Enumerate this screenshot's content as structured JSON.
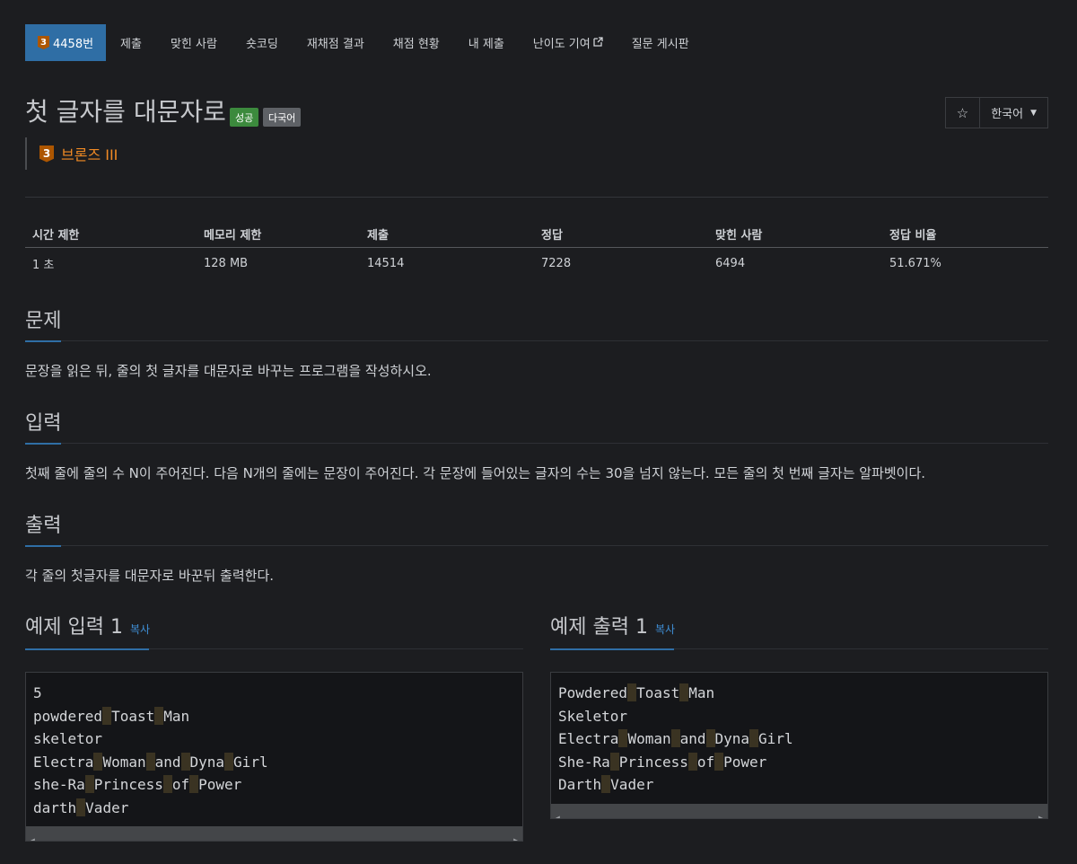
{
  "tabs": [
    {
      "label": "4458번",
      "tier_badge": "3"
    },
    {
      "label": "제출"
    },
    {
      "label": "맞힌 사람"
    },
    {
      "label": "숏코딩"
    },
    {
      "label": "재채점 결과"
    },
    {
      "label": "채점 현황"
    },
    {
      "label": "내 제출"
    },
    {
      "label": "난이도 기여"
    },
    {
      "label": "질문 게시판"
    }
  ],
  "problem": {
    "title": "첫 글자를 대문자로",
    "label_success": "성공",
    "label_multilang": "다국어",
    "tier_number": "3",
    "tier_name": "브론즈 III"
  },
  "controls": {
    "star": "☆",
    "language": "한국어"
  },
  "stats": {
    "headers": [
      "시간 제한",
      "메모리 제한",
      "제출",
      "정답",
      "맞힌 사람",
      "정답 비율"
    ],
    "values": [
      "1 초",
      "128 MB",
      "14514",
      "7228",
      "6494",
      "51.671%"
    ]
  },
  "sections": {
    "problem": {
      "title": "문제",
      "text": "문장을 읽은 뒤, 줄의 첫 글자를 대문자로 바꾸는 프로그램을 작성하시오."
    },
    "input": {
      "title": "입력",
      "text": "첫째 줄에 줄의 수 N이 주어진다. 다음 N개의 줄에는 문장이 주어진다. 각 문장에 들어있는 글자의 수는 30을 넘지 않는다. 모든 줄의 첫 번째 글자는 알파벳이다."
    },
    "output": {
      "title": "출력",
      "text": "각 줄의 첫글자를 대문자로 바꾼뒤 출력한다."
    }
  },
  "examples": {
    "input_title": "예제 입력 1",
    "output_title": "예제 출력 1",
    "copy_label": "복사",
    "input_lines": [
      "5",
      "powdered Toast Man",
      "skeletor",
      "Electra Woman and Dyna Girl",
      "she-Ra Princess of Power",
      "darth Vader"
    ],
    "output_lines": [
      "Powdered Toast Man",
      "Skeletor",
      "Electra Woman and Dyna Girl",
      "She-Ra Princess of Power",
      "Darth Vader"
    ]
  },
  "colors": {
    "accent": "#2f6ea5",
    "bronze": "#ad5600",
    "success": "#3c8a3d",
    "background": "#1c1d20"
  }
}
